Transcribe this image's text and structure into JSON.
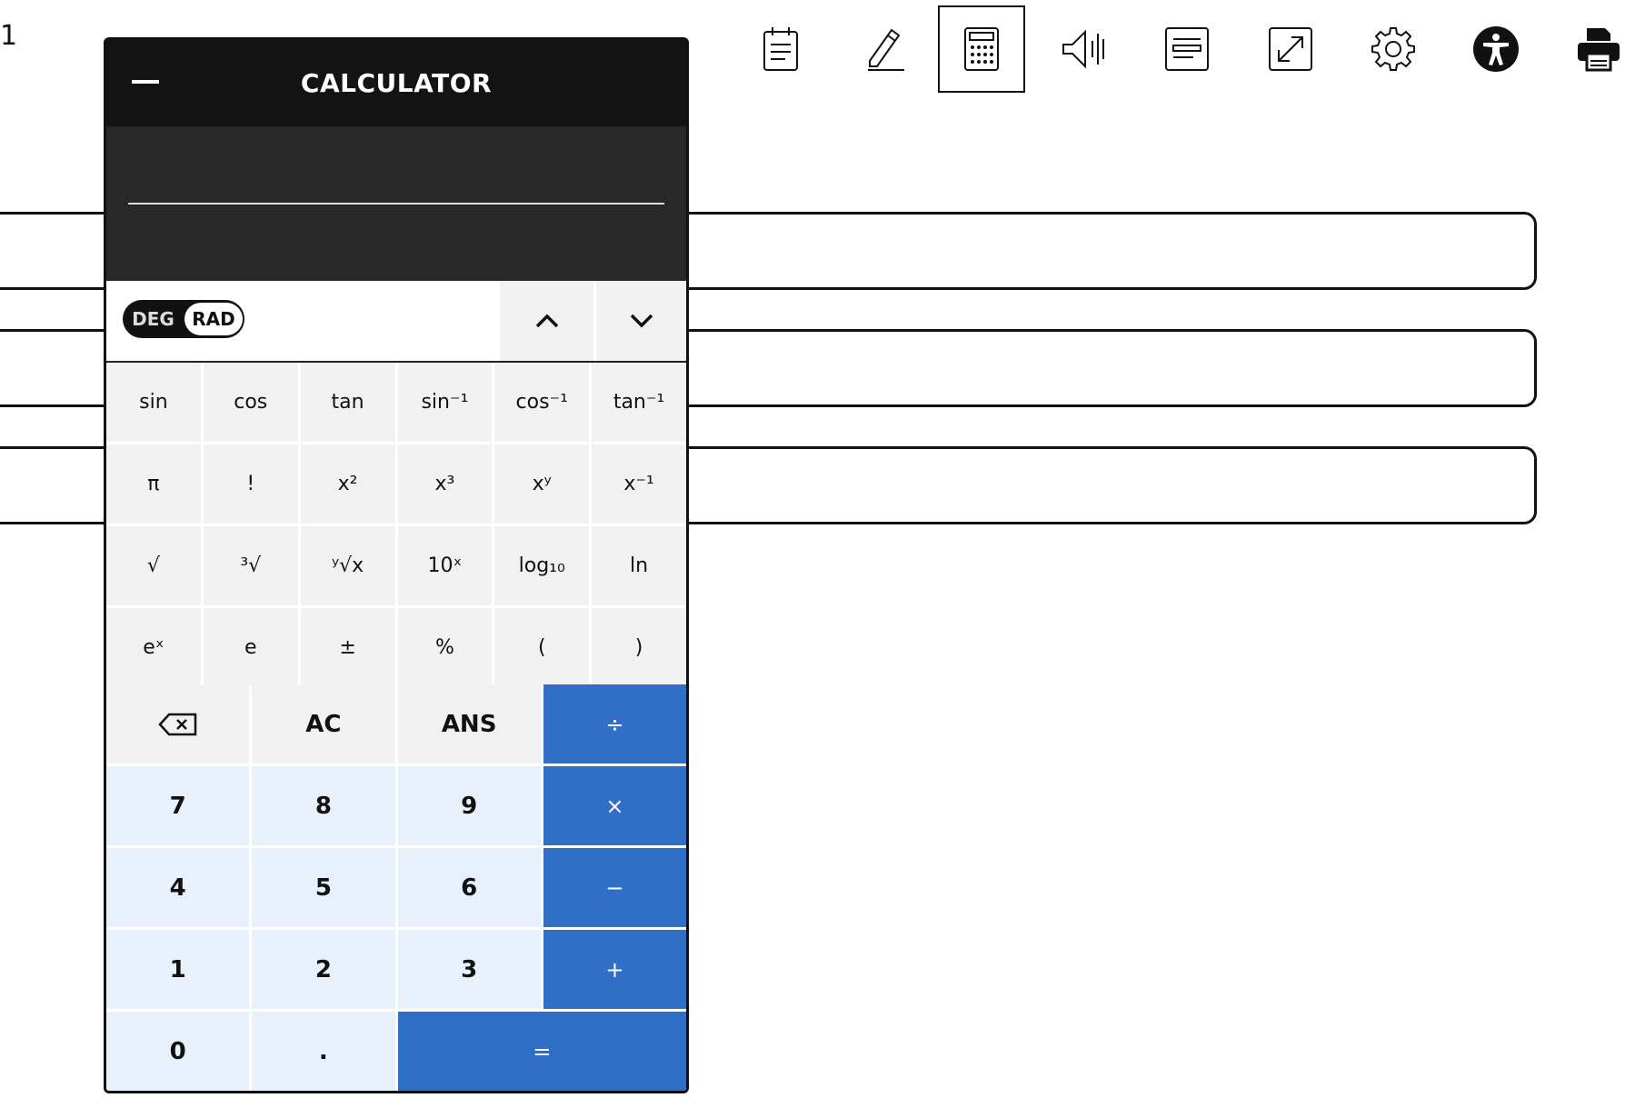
{
  "question": {
    "number": "1"
  },
  "toolbar": {
    "tools": [
      {
        "name": "notepad",
        "icon": "notepad-icon"
      },
      {
        "name": "highlighter",
        "icon": "highlighter-icon"
      },
      {
        "name": "calculator",
        "icon": "calculator-icon",
        "active": true
      },
      {
        "name": "text-to-speech",
        "icon": "speaker-icon"
      },
      {
        "name": "line-reader",
        "icon": "line-reader-icon"
      },
      {
        "name": "fullscreen",
        "icon": "expand-icon"
      },
      {
        "name": "settings",
        "icon": "gear-icon"
      },
      {
        "name": "accessibility",
        "icon": "accessibility-icon"
      },
      {
        "name": "print",
        "icon": "printer-icon"
      }
    ]
  },
  "calculator": {
    "title": "CALCULATOR",
    "display_value": "",
    "mode": {
      "deg_label": "DEG",
      "rad_label": "RAD",
      "selected": "RAD"
    },
    "scientific_keys": [
      [
        "sin",
        "cos",
        "tan",
        "sin⁻¹",
        "cos⁻¹",
        "tan⁻¹"
      ],
      [
        "π",
        "!",
        "x²",
        "x³",
        "xʸ",
        "x⁻¹"
      ],
      [
        "√",
        "³√",
        "ʸ√x",
        "10ˣ",
        "log₁₀",
        "ln"
      ],
      [
        "eˣ",
        "e",
        "±",
        "%",
        "(",
        ")"
      ]
    ],
    "keys": {
      "backspace": "backspace-icon",
      "ac": "AC",
      "ans": "ANS",
      "divide": "÷",
      "multiply": "×",
      "minus": "−",
      "plus": "+",
      "equals": "=",
      "decimal": ".",
      "digits": [
        "0",
        "1",
        "2",
        "3",
        "4",
        "5",
        "6",
        "7",
        "8",
        "9"
      ]
    }
  },
  "colors": {
    "operator_blue": "#2f6fc7",
    "number_key": "#e8f1fb",
    "function_key": "#f1f1f1",
    "header": "#131313"
  }
}
